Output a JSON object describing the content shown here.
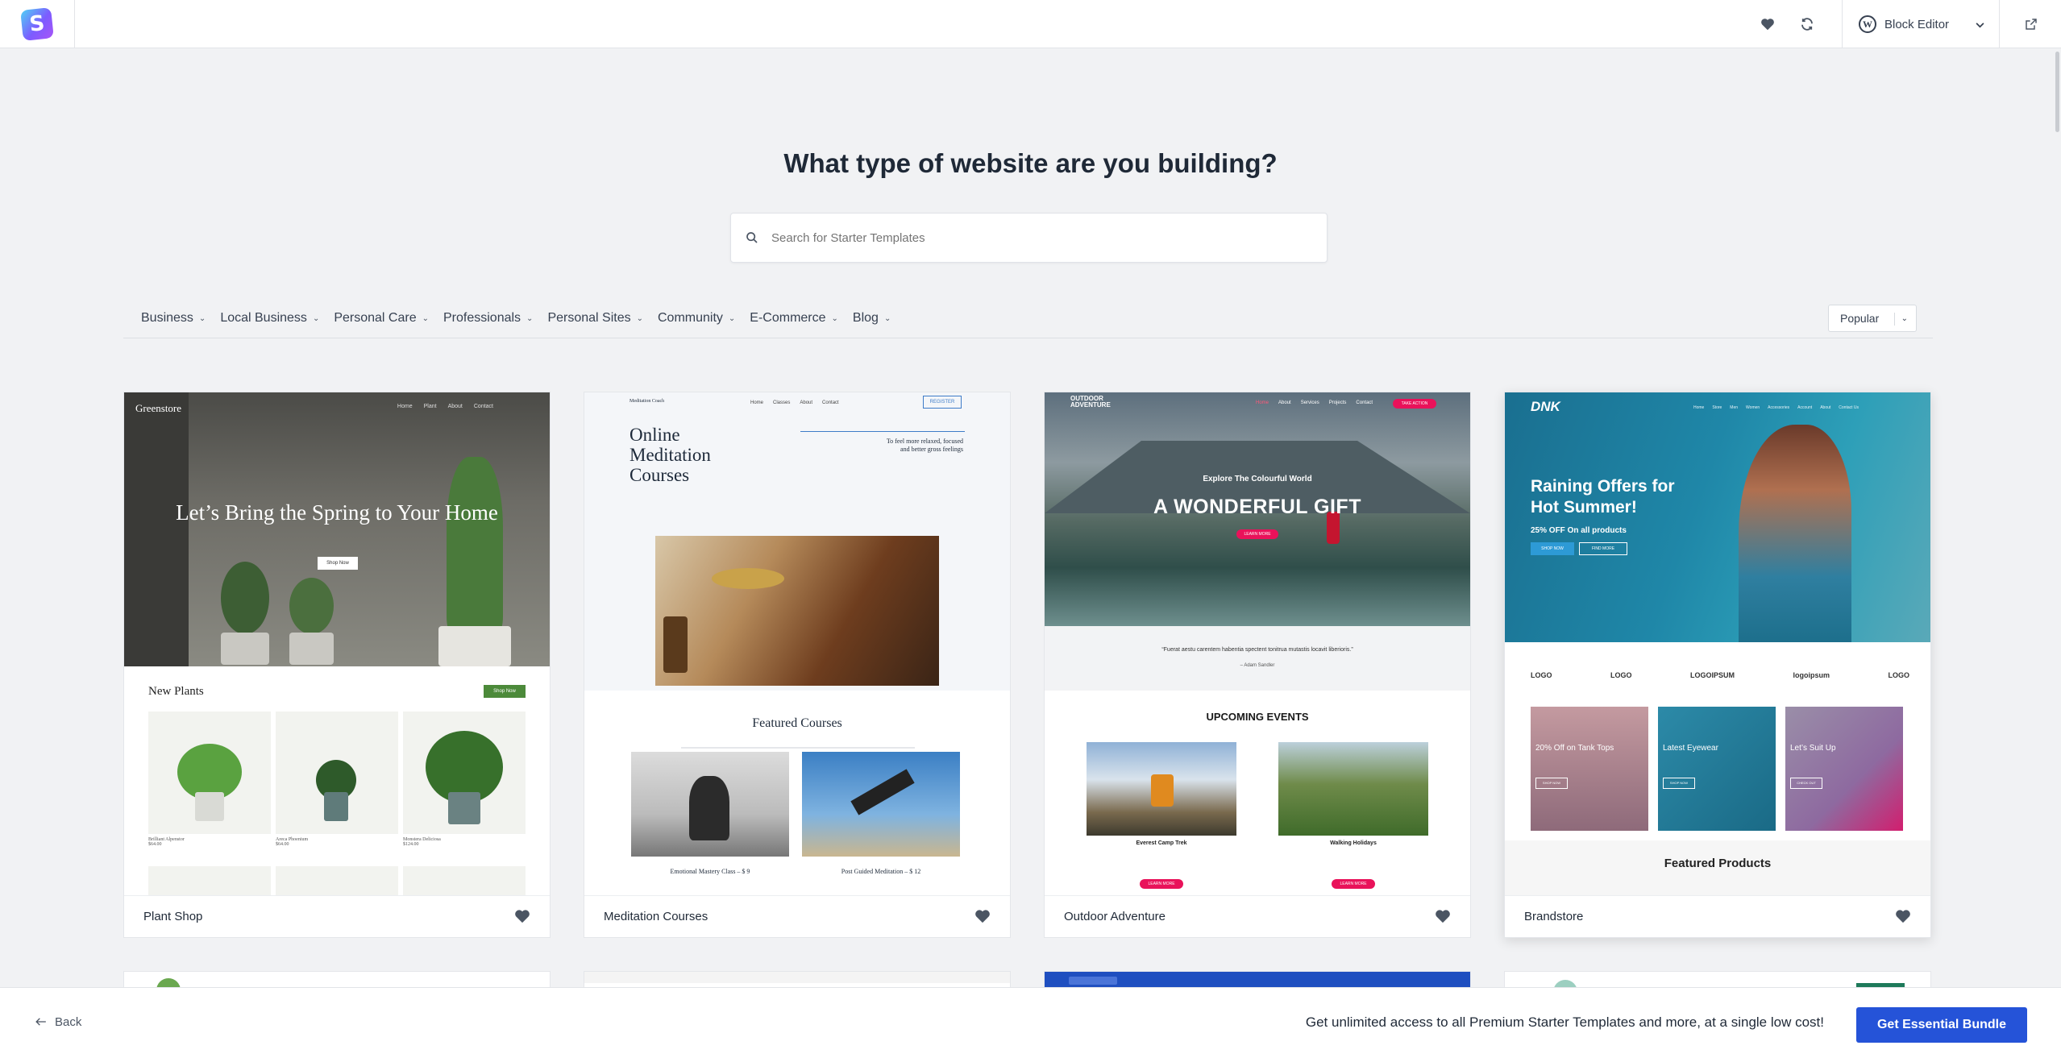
{
  "topbar": {
    "editor_label": "Block Editor",
    "icons": [
      "heart-icon",
      "refresh-icon",
      "external-link-icon"
    ]
  },
  "heading": "What type of website are you building?",
  "search": {
    "placeholder": "Search for Starter Templates"
  },
  "categories": [
    "Business",
    "Local Business",
    "Personal Care",
    "Professionals",
    "Personal Sites",
    "Community",
    "E-Commerce",
    "Blog"
  ],
  "sort": {
    "value": "Popular"
  },
  "cards": [
    {
      "name": "Plant Shop",
      "preview": {
        "brand": "Greenstore",
        "nav": [
          "Home",
          "Plant",
          "About",
          "Contact"
        ],
        "hero": "Let’s Bring the Spring to Your Home",
        "button": "Shop Now",
        "section": "New Plants",
        "section_button": "Shop Now",
        "products": [
          {
            "name": "Brilliant Alpenstor",
            "price": "$64.00"
          },
          {
            "name": "Areca Phoenium",
            "price": "$64.00"
          },
          {
            "name": "Monstera Deliciosa",
            "price": "$124.00"
          }
        ]
      }
    },
    {
      "name": "Meditation Courses",
      "preview": {
        "brand": "Meditation Coach",
        "nav": [
          "Home",
          "Classes",
          "About",
          "Contact"
        ],
        "button": "REGISTER",
        "hero": "Online Meditation Courses",
        "tagline": "To feel more relaxed, focused and better gross feelings",
        "section": "Featured Courses",
        "courses": [
          "Emotional Mastery Class – $ 9",
          "Post Guided Meditation – $ 12"
        ]
      }
    },
    {
      "name": "Outdoor Adventure",
      "preview": {
        "brand": "OUTDOOR ADVENTURE",
        "nav": [
          "Home",
          "About",
          "Services",
          "Projects",
          "Contact"
        ],
        "nav_button": "TAKE ACTION",
        "kicker": "Explore The Colourful World",
        "hero": "A WONDERFUL GIFT",
        "button": "LEARN MORE",
        "quote": "“Fuerat aestu carentem habentia spectent tonitrua mutastis locavit liberioris.”",
        "quote_author": "– Adam Sandler",
        "section": "UPCOMING EVENTS",
        "events": [
          "Everest Camp Trek",
          "Walking Holidays"
        ],
        "event_button": "LEARN MORE"
      }
    },
    {
      "name": "Brandstore",
      "preview": {
        "brand": "DNK",
        "nav": [
          "Home",
          "Store",
          "Men",
          "Women",
          "Accessories",
          "Account",
          "About",
          "Contact Us"
        ],
        "hero": "Raining Offers for Hot Summer!",
        "sub": "25% OFF On all products",
        "buttons": [
          "SHOP NOW",
          "FIND MORE"
        ],
        "logos": [
          "LOGO",
          "LOGO",
          "LOGOIPSUM",
          "logoipsum",
          "LOGO"
        ],
        "tiles": [
          "20% Off on Tank Tops",
          "Latest Eyewear",
          "Let’s Suit Up"
        ],
        "tile_buttons": [
          "SHOP NOW",
          "SHOP NOW",
          "CHECK OUT"
        ],
        "section": "Featured Products"
      }
    }
  ],
  "bottombar": {
    "back": "Back",
    "promo": "Get unlimited access to all Premium Starter Templates and more, at a single low cost!",
    "cta": "Get Essential Bundle"
  },
  "colors": {
    "accent": "#2553d8",
    "plant_green": "#4c8a3a",
    "outdoor_pink": "#e9125a",
    "brandstore_blue": "#1f87a8"
  }
}
